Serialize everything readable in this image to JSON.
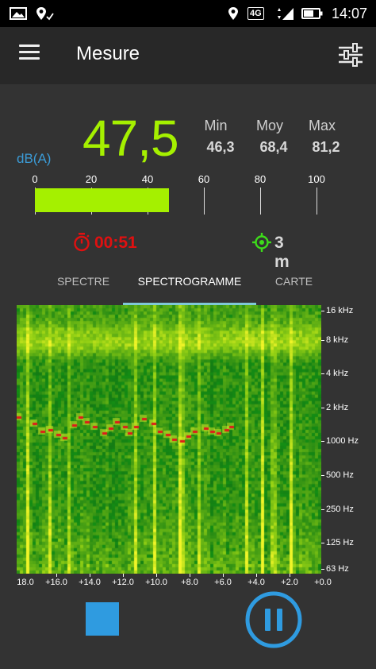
{
  "status_bar": {
    "time": "14:07",
    "network": "4G",
    "icons": [
      "image-icon",
      "location-pin-icon",
      "location-icon",
      "network-4g-icon",
      "signal-icon",
      "battery-icon"
    ]
  },
  "app_bar": {
    "title": "Mesure",
    "menu_icon": "hamburger-icon",
    "settings_icon": "sliders-icon"
  },
  "measurement": {
    "value": "47,5",
    "unit": "dB(A)",
    "level": 47.5,
    "stats": [
      {
        "label": "Min",
        "value": "46,3"
      },
      {
        "label": "Moy",
        "value": "68,4"
      },
      {
        "label": "Max",
        "value": "81,2"
      }
    ],
    "scale": [
      "0",
      "20",
      "40",
      "60",
      "80",
      "100"
    ],
    "scale_max": 100
  },
  "timer": {
    "icon": "stopwatch-icon",
    "value": "00:51"
  },
  "gps": {
    "icon": "gps-target-icon",
    "value": "3 m"
  },
  "tabs": [
    {
      "label": "SPECTRE",
      "active": false
    },
    {
      "label": "SPECTROGRAMME",
      "active": true
    },
    {
      "label": "CARTE",
      "active": false
    }
  ],
  "spectrogram": {
    "freq_labels": [
      "16 kHz",
      "8 kHz",
      "4 kHz",
      "2 kHz",
      "1000 Hz",
      "500 Hz",
      "250 Hz",
      "125 Hz",
      "63 Hz"
    ],
    "time_labels": [
      "18.0",
      "+16.0",
      "+14.0",
      "+12.0",
      "+10.0",
      "+8.0",
      "+6.0",
      "+4.0",
      "+2.0",
      "+0.0"
    ]
  },
  "controls": {
    "stop_icon": "stop-icon",
    "pause_icon": "pause-icon"
  },
  "colors": {
    "level_green": "#a5f000",
    "unit_blue": "#3b9bd6",
    "timer_red": "#e01010",
    "gps_green": "#3ddc1a",
    "control_blue": "#2f9be0",
    "tab_indicator": "#7fc9d6"
  }
}
